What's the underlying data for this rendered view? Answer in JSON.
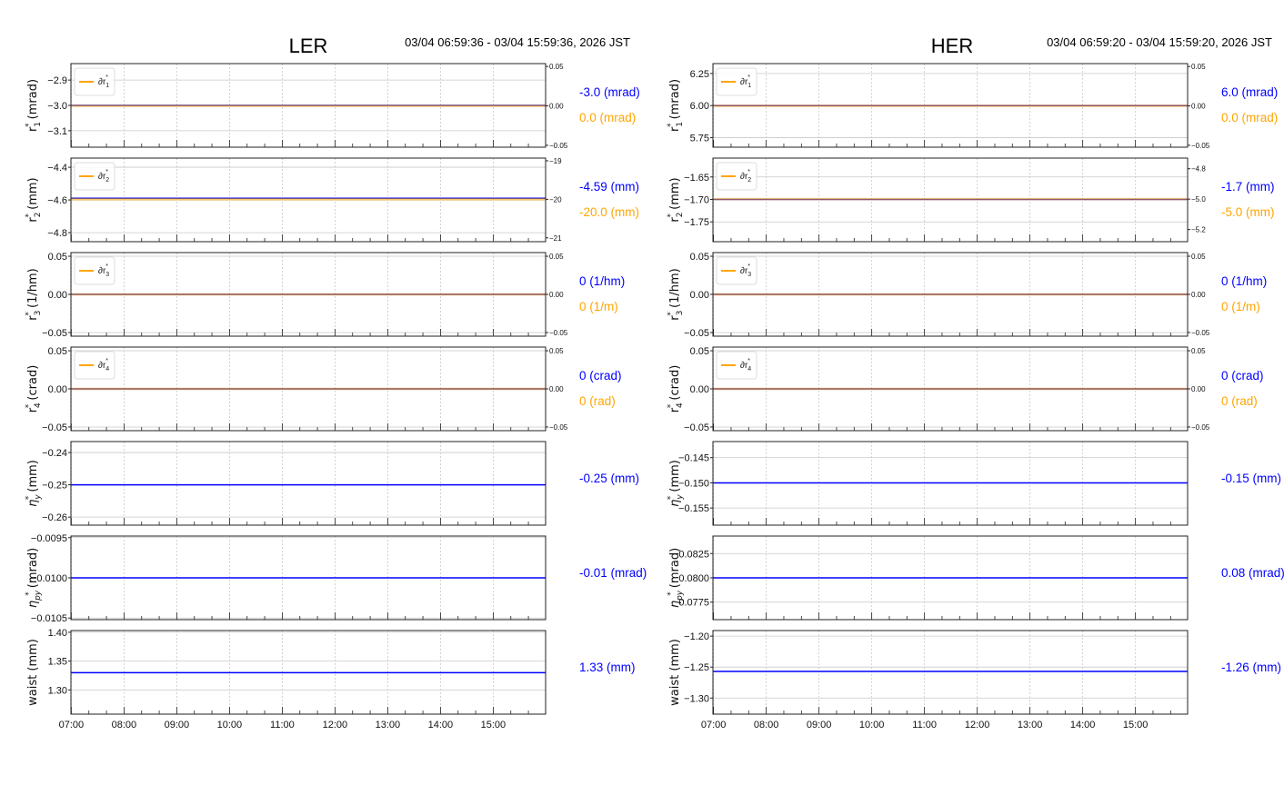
{
  "colors": {
    "main": "#0000ff",
    "delta": "#ffa500",
    "grid": "#c8c8c8",
    "axis": "#222222"
  },
  "chart_data": [
    {
      "type": "line",
      "title": "LER",
      "time_range": "03/04 06:59:36 - 03/04 15:59:36, 2026 JST",
      "xlim_hours": [
        6.993,
        15.993
      ],
      "xticks": [
        7,
        8,
        9,
        10,
        11,
        12,
        13,
        14,
        15
      ],
      "xtick_labels": [
        "07:00",
        "08:00",
        "09:00",
        "10:00",
        "11:00",
        "12:00",
        "13:00",
        "14:00",
        "15:00"
      ],
      "panels": [
        {
          "sym": "r",
          "sub": "1",
          "sup": "*",
          "unit": " (mrad)",
          "ylim": [
            -3.165,
            -2.835
          ],
          "yticks": [
            -2.9,
            -3.0,
            -3.1
          ],
          "ytick_labels": [
            "−2.9",
            "−3.0",
            "−3.1"
          ],
          "value": -3.0,
          "right": {
            "ylim": [
              -0.0524,
              0.0536
            ],
            "yticks": [
              0.05,
              0,
              -0.05
            ],
            "ytick_labels": [
              "0.05",
              "0.00",
              "−0.05"
            ],
            "value": 0
          },
          "legend": {
            "sym": "∂r",
            "sub": "1",
            "sup": "*"
          },
          "readout": "-3.0 (mrad)",
          "readout2": "0.0 (mrad)"
        },
        {
          "sym": "r",
          "sub": "2",
          "sup": "*",
          "unit": " (mm)",
          "ylim": [
            -4.855,
            -4.344
          ],
          "yticks": [
            -4.4,
            -4.6,
            -4.8
          ],
          "ytick_labels": [
            "−4.4",
            "−4.6",
            "−4.8"
          ],
          "value": -4.59,
          "right": {
            "ylim": [
              -21.1,
              -18.93
            ],
            "yticks": [
              -19,
              -20,
              -21
            ],
            "ytick_labels": [
              "−19",
              "−20",
              "−21"
            ],
            "value": -20.0
          },
          "legend": {
            "sym": "∂r",
            "sub": "2",
            "sup": "*"
          },
          "readout": "-4.59 (mm)",
          "readout2": "-20.0 (mm)"
        },
        {
          "sym": "r",
          "sub": "3",
          "sup": "*",
          "unit": " (1/hm)",
          "ylim": [
            -0.0548,
            0.0548
          ],
          "yticks": [
            0.05,
            0,
            -0.05
          ],
          "ytick_labels": [
            "0.05",
            "0.00",
            "−0.05"
          ],
          "value": 0,
          "right": {
            "ylim": [
              -0.0548,
              0.0548
            ],
            "yticks": [
              0.05,
              0,
              -0.05
            ],
            "ytick_labels": [
              "0.05",
              "0.00",
              "−0.05"
            ],
            "value": 0
          },
          "legend": {
            "sym": "∂r",
            "sub": "3",
            "sup": "*"
          },
          "readout": "0 (1/hm)",
          "readout2": "0 (1/m)"
        },
        {
          "sym": "r",
          "sub": "4",
          "sup": "*",
          "unit": " (crad)",
          "ylim": [
            -0.0548,
            0.0548
          ],
          "yticks": [
            0.05,
            0,
            -0.05
          ],
          "ytick_labels": [
            "0.05",
            "0.00",
            "−0.05"
          ],
          "value": 0,
          "right": {
            "ylim": [
              -0.0548,
              0.0548
            ],
            "yticks": [
              0.05,
              0,
              -0.05
            ],
            "ytick_labels": [
              "0.05",
              "0.00",
              "−0.05"
            ],
            "value": 0
          },
          "legend": {
            "sym": "∂r",
            "sub": "4",
            "sup": "*"
          },
          "readout": "0 (crad)",
          "readout2": "0 (rad)"
        },
        {
          "sym": "η",
          "sub": "y",
          "sup": "*",
          "unit": " (mm)",
          "ylim": [
            -0.2625,
            -0.2366
          ],
          "yticks": [
            -0.24,
            -0.25,
            -0.26
          ],
          "ytick_labels": [
            "−0.24",
            "−0.25",
            "−0.26"
          ],
          "value": -0.25,
          "readout": "-0.25 (mm)"
        },
        {
          "sym": "η",
          "sub": "py",
          "sup": "*",
          "unit": " (mrad)",
          "ylim": [
            -0.01052,
            -0.00948
          ],
          "yticks": [
            -0.0095,
            -0.01,
            -0.0105
          ],
          "ytick_labels": [
            "−0.0095",
            "−0.0100",
            "−0.0105"
          ],
          "value": -0.01,
          "readout": "-0.01 (mrad)"
        },
        {
          "sym": "waist",
          "sub": "",
          "sup": "",
          "unit": " (mm)",
          "ylim": [
            1.258,
            1.403
          ],
          "yticks": [
            1.4,
            1.35,
            1.3
          ],
          "ytick_labels": [
            "1.40",
            "1.35",
            "1.30"
          ],
          "value": 1.33,
          "readout": "1.33 (mm)"
        }
      ]
    },
    {
      "type": "line",
      "title": "HER",
      "time_range": "03/04 06:59:20 - 03/04 15:59:20, 2026 JST",
      "xlim_hours": [
        6.989,
        15.989
      ],
      "xticks": [
        7,
        8,
        9,
        10,
        11,
        12,
        13,
        14,
        15
      ],
      "xtick_labels": [
        "07:00",
        "08:00",
        "09:00",
        "10:00",
        "11:00",
        "12:00",
        "13:00",
        "14:00",
        "15:00"
      ],
      "panels": [
        {
          "sym": "r",
          "sub": "1",
          "sup": "*",
          "unit": " (mrad)",
          "ylim": [
            5.676,
            6.327
          ],
          "yticks": [
            6.25,
            6.0,
            5.75
          ],
          "ytick_labels": [
            "6.25",
            "6.00",
            "5.75"
          ],
          "value": 6.0,
          "right": {
            "ylim": [
              -0.0524,
              0.0536
            ],
            "yticks": [
              0.05,
              0,
              -0.05
            ],
            "ytick_labels": [
              "0.05",
              "0.00",
              "−0.05"
            ],
            "value": 0
          },
          "legend": {
            "sym": "∂r",
            "sub": "1",
            "sup": "*"
          },
          "readout": "6.0 (mrad)",
          "readout2": "0.0 (mrad)"
        },
        {
          "sym": "r",
          "sub": "2",
          "sup": "*",
          "unit": " (mm)",
          "ylim": [
            -1.794,
            -1.608
          ],
          "yticks": [
            -1.65,
            -1.7,
            -1.75
          ],
          "ytick_labels": [
            "−1.65",
            "−1.70",
            "−1.75"
          ],
          "value": -1.7,
          "right": {
            "ylim": [
              -5.28,
              -4.73
            ],
            "yticks": [
              -4.8,
              -5.0,
              -5.2
            ],
            "ytick_labels": [
              "−4.8",
              "−5.0",
              "−5.2"
            ],
            "value": -5.0
          },
          "legend": {
            "sym": "∂r",
            "sub": "2",
            "sup": "*"
          },
          "readout": "-1.7 (mm)",
          "readout2": "-5.0 (mm)"
        },
        {
          "sym": "r",
          "sub": "3",
          "sup": "*",
          "unit": " (1/hm)",
          "ylim": [
            -0.0548,
            0.0548
          ],
          "yticks": [
            0.05,
            0,
            -0.05
          ],
          "ytick_labels": [
            "0.05",
            "0.00",
            "−0.05"
          ],
          "value": 0,
          "right": {
            "ylim": [
              -0.0548,
              0.0548
            ],
            "yticks": [
              0.05,
              0,
              -0.05
            ],
            "ytick_labels": [
              "0.05",
              "0.00",
              "−0.05"
            ],
            "value": 0
          },
          "legend": {
            "sym": "∂r",
            "sub": "3",
            "sup": "*"
          },
          "readout": "0 (1/hm)",
          "readout2": "0 (1/m)"
        },
        {
          "sym": "r",
          "sub": "4",
          "sup": "*",
          "unit": " (crad)",
          "ylim": [
            -0.0548,
            0.0548
          ],
          "yticks": [
            0.05,
            0,
            -0.05
          ],
          "ytick_labels": [
            "0.05",
            "0.00",
            "−0.05"
          ],
          "value": 0,
          "right": {
            "ylim": [
              -0.0548,
              0.0548
            ],
            "yticks": [
              0.05,
              0,
              -0.05
            ],
            "ytick_labels": [
              "0.05",
              "0.00",
              "−0.05"
            ],
            "value": 0
          },
          "legend": {
            "sym": "∂r",
            "sub": "4",
            "sup": "*"
          },
          "readout": "0 (crad)",
          "readout2": "0 (rad)"
        },
        {
          "sym": "η",
          "sub": "y",
          "sup": "*",
          "unit": " (mm)",
          "ylim": [
            -0.1584,
            -0.1418
          ],
          "yticks": [
            -0.145,
            -0.15,
            -0.155
          ],
          "ytick_labels": [
            "−0.145",
            "−0.150",
            "−0.155"
          ],
          "value": -0.15,
          "readout": "-0.15 (mm)"
        },
        {
          "sym": "η",
          "sub": "py",
          "sup": "*",
          "unit": " (mrad)",
          "ylim": [
            0.0757,
            0.0843
          ],
          "yticks": [
            0.0825,
            0.08,
            0.0775
          ],
          "ytick_labels": [
            "0.0825",
            "0.0800",
            "0.0775"
          ],
          "value": 0.08,
          "readout": "0.08 (mrad)"
        },
        {
          "sym": "waist",
          "sub": "",
          "sup": "",
          "unit": " (mm)",
          "ylim": [
            -1.326,
            -1.191
          ],
          "yticks": [
            -1.2,
            -1.25,
            -1.3
          ],
          "ytick_labels": [
            "−1.20",
            "−1.25",
            "−1.30"
          ],
          "value": -1.257,
          "readout": "-1.26 (mm)"
        }
      ]
    }
  ]
}
